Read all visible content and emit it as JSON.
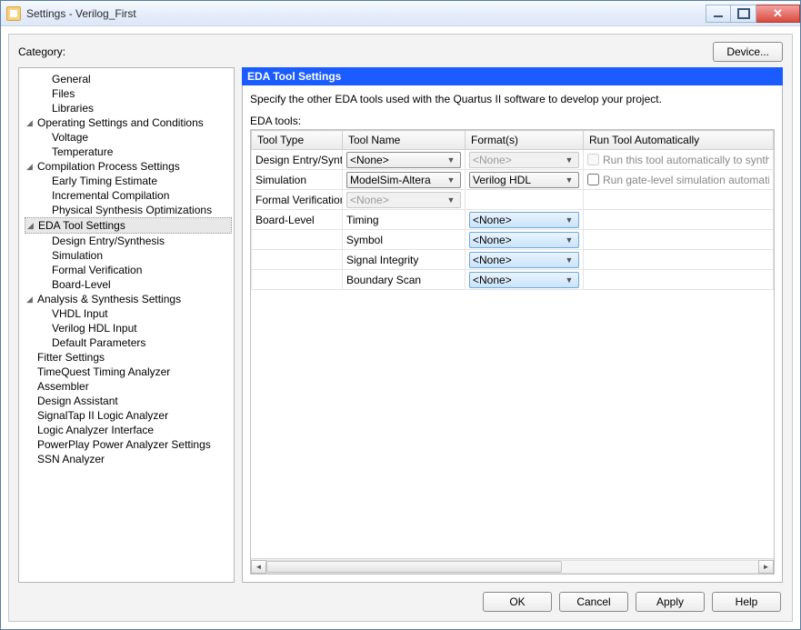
{
  "window": {
    "title": "Settings - Verilog_First"
  },
  "top": {
    "category_label": "Category:",
    "device_button": "Device..."
  },
  "tree": {
    "items": [
      {
        "label": "General",
        "indent": 1
      },
      {
        "label": "Files",
        "indent": 1
      },
      {
        "label": "Libraries",
        "indent": 1
      },
      {
        "label": "Operating Settings and Conditions",
        "indent": 0,
        "expanded": true
      },
      {
        "label": "Voltage",
        "indent": 1
      },
      {
        "label": "Temperature",
        "indent": 1
      },
      {
        "label": "Compilation Process Settings",
        "indent": 0,
        "expanded": true
      },
      {
        "label": "Early Timing Estimate",
        "indent": 1
      },
      {
        "label": "Incremental Compilation",
        "indent": 1
      },
      {
        "label": "Physical Synthesis Optimizations",
        "indent": 1
      },
      {
        "label": "EDA Tool Settings",
        "indent": 0,
        "expanded": true,
        "selected": true
      },
      {
        "label": "Design Entry/Synthesis",
        "indent": 1
      },
      {
        "label": "Simulation",
        "indent": 1
      },
      {
        "label": "Formal Verification",
        "indent": 1
      },
      {
        "label": "Board-Level",
        "indent": 1
      },
      {
        "label": "Analysis & Synthesis Settings",
        "indent": 0,
        "expanded": true
      },
      {
        "label": "VHDL Input",
        "indent": 1
      },
      {
        "label": "Verilog HDL Input",
        "indent": 1
      },
      {
        "label": "Default Parameters",
        "indent": 1
      },
      {
        "label": "Fitter Settings",
        "indent": 0
      },
      {
        "label": "TimeQuest Timing Analyzer",
        "indent": 0
      },
      {
        "label": "Assembler",
        "indent": 0
      },
      {
        "label": "Design Assistant",
        "indent": 0
      },
      {
        "label": "SignalTap II Logic Analyzer",
        "indent": 0
      },
      {
        "label": "Logic Analyzer Interface",
        "indent": 0
      },
      {
        "label": "PowerPlay Power Analyzer Settings",
        "indent": 0
      },
      {
        "label": "SSN Analyzer",
        "indent": 0
      }
    ]
  },
  "panel": {
    "title": "EDA Tool Settings",
    "description": "Specify the other EDA tools used with the Quartus II software to develop your project.",
    "table_label": "EDA tools:",
    "columns": {
      "c0": "Tool Type",
      "c1": "Tool Name",
      "c2": "Format(s)",
      "c3": "Run Tool Automatically"
    },
    "none_label": "<None>",
    "rows": {
      "r0": {
        "type": "Design Entry/Synthesis",
        "name": "<None>",
        "format": "<None>",
        "auto": "Run this tool automatically to synthes"
      },
      "r1": {
        "type": "Simulation",
        "name": "ModelSim-Altera",
        "format": "Verilog HDL",
        "auto": "Run gate-level simulation automaticall"
      },
      "r2": {
        "type": "Formal Verification",
        "name": "<None>"
      },
      "r3": {
        "type": "Board-Level",
        "sub": "Timing",
        "format": "<None>"
      },
      "r4": {
        "sub": "Symbol",
        "format": "<None>"
      },
      "r5": {
        "sub": "Signal Integrity",
        "format": "<None>"
      },
      "r6": {
        "sub": "Boundary Scan",
        "format": "<None>"
      }
    }
  },
  "footer": {
    "ok": "OK",
    "cancel": "Cancel",
    "apply": "Apply",
    "help": "Help"
  }
}
